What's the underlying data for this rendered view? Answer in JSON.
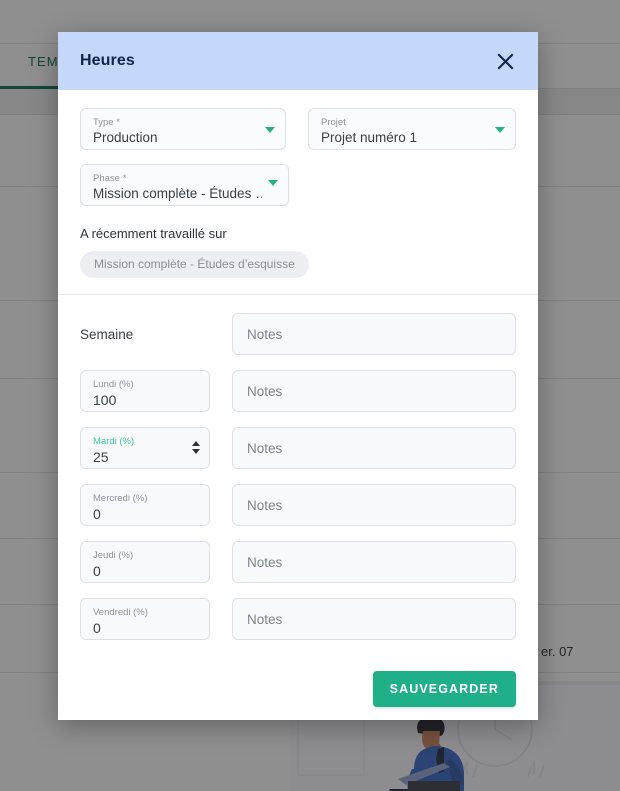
{
  "background": {
    "tab_label": "TEM",
    "date_cell": "er. 07",
    "illustration_alt": "person-at-laptop-illustration"
  },
  "modal": {
    "title": "Heures",
    "close_icon": "close-icon",
    "top_section": {
      "type": {
        "label": "Type *",
        "value": "Production",
        "caret_icon": "chevron-down-icon"
      },
      "projet": {
        "label": "Projet",
        "value": "Projet numéro 1",
        "caret_icon": "chevron-down-icon"
      },
      "phase": {
        "label": "Phase *",
        "value": "Mission complète - Études …",
        "caret_icon": "chevron-down-icon"
      },
      "recent_label": "A récemment travaillé sur",
      "recent_chips": [
        "Mission complète - Études d’esquisse"
      ]
    },
    "week_section": {
      "week_title": "Semaine",
      "week_notes_placeholder": "Notes",
      "notes_placeholder": "Notes",
      "days": [
        {
          "label": "Lundi (%)",
          "value": "100",
          "notes": "",
          "focused": false
        },
        {
          "label": "Mardi (%)",
          "value": "25",
          "notes": "",
          "focused": true
        },
        {
          "label": "Mercredi (%)",
          "value": "0",
          "notes": "",
          "focused": false
        },
        {
          "label": "Jeudi (%)",
          "value": "0",
          "notes": "",
          "focused": false
        },
        {
          "label": "Vendredi (%)",
          "value": "0",
          "notes": "",
          "focused": false
        }
      ]
    },
    "footer": {
      "save_label": "SAUVEGARDER"
    }
  },
  "colors": {
    "header_blue": "#c5d8fb",
    "title_navy": "#122447",
    "accent_green": "#20b087",
    "focus_green": "#3ec9a0",
    "tab_green": "#00684a",
    "field_bg": "#f8f9fb",
    "field_border": "#dde0e4",
    "chip_bg": "#eceef1"
  }
}
